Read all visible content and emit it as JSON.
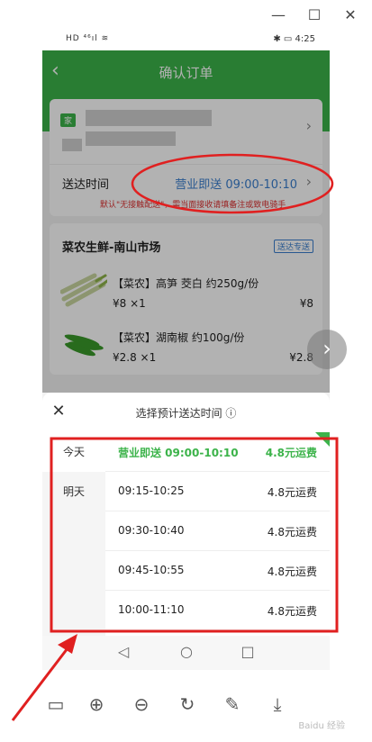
{
  "window": {
    "close_glyph": "✕",
    "maximize_glyph": "☐",
    "minimize_glyph": "—"
  },
  "status_bar": {
    "left": "HD ⁴⁶ıl ≋",
    "right": "✱ ▭ 4:25"
  },
  "header": {
    "back_glyph": "‹",
    "title": "确认订单"
  },
  "address": {
    "tag": "家"
  },
  "delivery": {
    "label": "送达时间",
    "value": "营业即送 09:00-10:10",
    "note": "默认\"无接触配送\"，需当面接收请填备注或致电骑手"
  },
  "store": {
    "name": "菜农生鲜-南山市场",
    "tag": "送达专送",
    "products": [
      {
        "name": "【菜农】高笋 茭白  约250g/份",
        "price": "¥8 ×1",
        "total": "¥8"
      },
      {
        "name": "【菜农】湖南椒  约100g/份",
        "price": "¥2.8 ×1",
        "total": "¥2.8"
      }
    ]
  },
  "sheet": {
    "title": "选择预计送达时间 ⓘ",
    "days": [
      "今天",
      "明天"
    ],
    "slots": [
      {
        "time": "营业即送 09:00-10:10",
        "fee": "4.8元运费",
        "selected": true
      },
      {
        "time": "09:15-10:25",
        "fee": "4.8元运费",
        "selected": false
      },
      {
        "time": "09:30-10:40",
        "fee": "4.8元运费",
        "selected": false
      },
      {
        "time": "09:45-10:55",
        "fee": "4.8元运费",
        "selected": false
      },
      {
        "time": "10:00-11:10",
        "fee": "4.8元运费",
        "selected": false
      }
    ]
  },
  "android_nav": {
    "back": "◁",
    "home": "○",
    "recent": "□"
  },
  "viewer_toolbar": [
    "▭",
    "⊕",
    "⊖",
    "↻",
    "✎",
    "⤓"
  ],
  "watermark": "Baidu 经验",
  "colors": {
    "accent": "#3cb34a",
    "link": "#3a7fcf",
    "annotation": "#e02020"
  }
}
